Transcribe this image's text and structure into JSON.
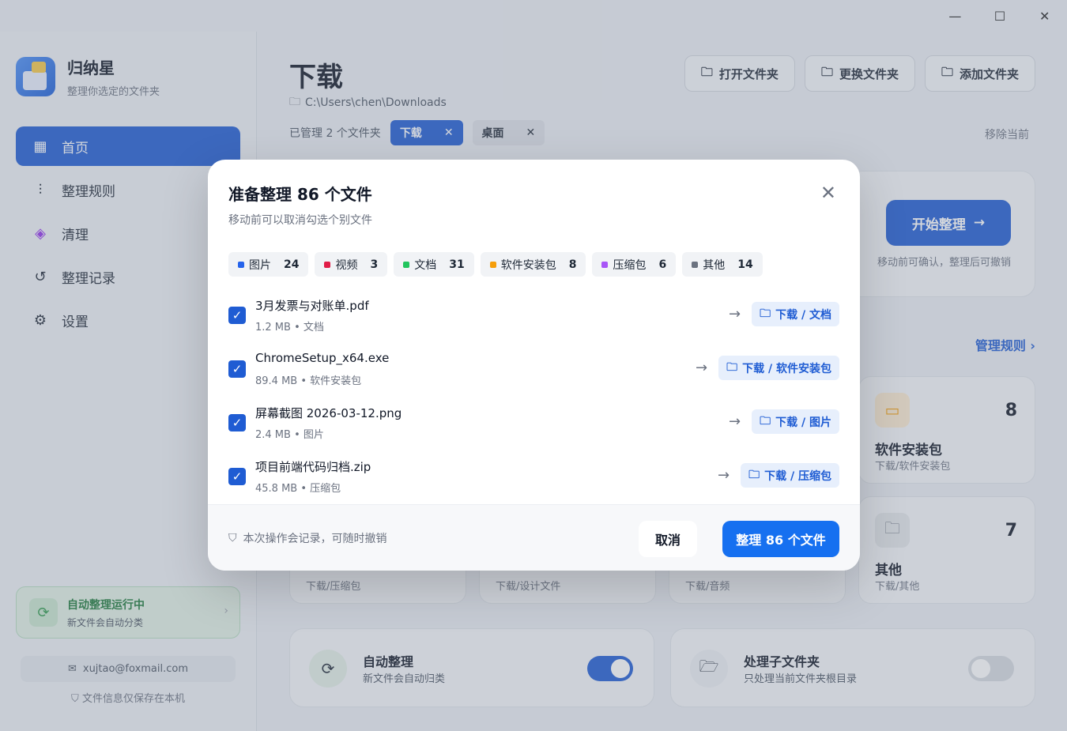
{
  "app": {
    "name": "归纳星",
    "subtitle": "整理你选定的文件夹"
  },
  "window_controls": {
    "minimize": "—",
    "maximize": "☐",
    "close": "✕"
  },
  "sidebar": {
    "items": [
      {
        "label": "首页",
        "icon": "grid-icon",
        "active": true
      },
      {
        "label": "整理规则",
        "icon": "sliders-icon"
      },
      {
        "label": "清理",
        "icon": "cube-icon"
      },
      {
        "label": "整理记录",
        "icon": "history-icon"
      },
      {
        "label": "设置",
        "icon": "gear-icon"
      }
    ],
    "auto_card": {
      "title": "自动整理运行中",
      "sub": "新文件会自动分类"
    },
    "email": "xujtao@foxmail.com",
    "local_note": "文件信息仅保存在本机"
  },
  "main": {
    "title": "下载",
    "path": "C:\\Users\\chen\\Downloads",
    "buttons": [
      "打开文件夹",
      "更换文件夹",
      "添加文件夹"
    ],
    "managed_label": "已管理 2 个文件夹",
    "chips": [
      {
        "label": "下载",
        "active": true
      },
      {
        "label": "桌面",
        "active": false
      }
    ],
    "remove_current": "移除当前",
    "start_button": "开始整理",
    "start_note": "移动前可确认，整理后可撤销",
    "manage_rules": "管理规则",
    "categories": [
      {
        "name": "软件安装包",
        "path": "下载/软件安装包",
        "count": "8"
      },
      {
        "name": "其他",
        "path": "下载/其他",
        "count": "7"
      }
    ],
    "partial_paths": [
      "下载/压缩包",
      "下载/设计文件",
      "下载/音频"
    ],
    "toggles": [
      {
        "title": "自动整理",
        "sub": "新文件会自动归类",
        "on": true
      },
      {
        "title": "处理子文件夹",
        "sub": "只处理当前文件夹根目录",
        "on": false
      }
    ]
  },
  "modal": {
    "title": "准备整理 86 个文件",
    "subtitle": "移动前可以取消勾选个别文件",
    "tags": [
      {
        "label": "图片",
        "count": "24",
        "color": "#2563eb"
      },
      {
        "label": "视频",
        "count": "3",
        "color": "#e11d48"
      },
      {
        "label": "文档",
        "count": "31",
        "color": "#22c55e"
      },
      {
        "label": "软件安装包",
        "count": "8",
        "color": "#f59e0b"
      },
      {
        "label": "压缩包",
        "count": "6",
        "color": "#a855f7"
      },
      {
        "label": "其他",
        "count": "14",
        "color": "#6b7280"
      }
    ],
    "files": [
      {
        "name": "3月发票与对账单.pdf",
        "size": "1.2 MB",
        "type": "文档",
        "dest": "下载 / 文档"
      },
      {
        "name": "ChromeSetup_x64.exe",
        "size": "89.4 MB",
        "type": "软件安装包",
        "dest": "下载 / 软件安装包"
      },
      {
        "name": "屏幕截图 2026-03-12.png",
        "size": "2.4 MB",
        "type": "图片",
        "dest": "下载 / 图片"
      },
      {
        "name": "项目前端代码归档.zip",
        "size": "45.8 MB",
        "type": "压缩包",
        "dest": "下载 / 压缩包"
      }
    ],
    "footer_note": "本次操作会记录，可随时撤销",
    "cancel": "取消",
    "confirm": "整理 86 个文件"
  },
  "colors": {
    "accent": "#1f5cd3",
    "confirm": "#1670f0"
  }
}
